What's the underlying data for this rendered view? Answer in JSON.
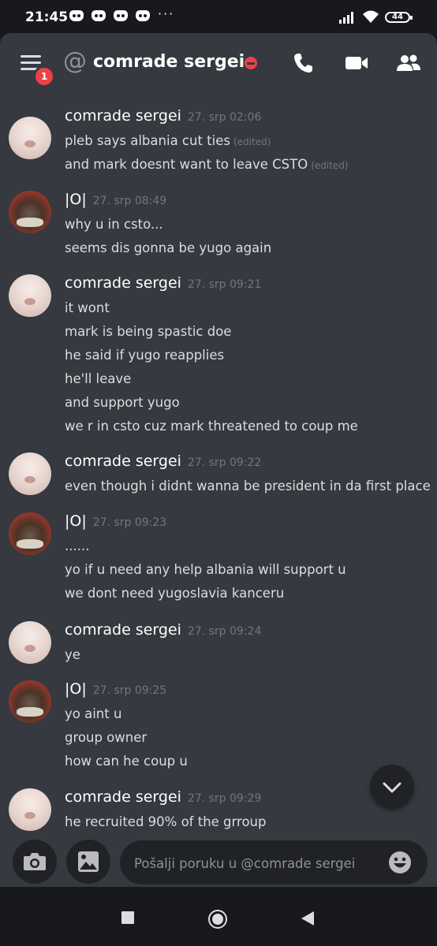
{
  "status_bar": {
    "time": "21:45",
    "overflow": "···",
    "battery": "44"
  },
  "header": {
    "menu_badge": "1",
    "at_symbol": "@",
    "channel_name": "comrade sergei"
  },
  "messages": [
    {
      "author": "comrade sergei",
      "avatar": "cat-avatar",
      "timestamp": "27. srp 02:06",
      "lines": [
        {
          "text": "pleb says albania cut ties",
          "edited": "(edited)"
        },
        {
          "text": "and mark doesnt want to leave CSTO",
          "edited": "(edited)"
        }
      ]
    },
    {
      "author": "|O|",
      "avatar": "dark-avatar",
      "timestamp": "27. srp 08:49",
      "lines": [
        {
          "text": "why u in csto..."
        },
        {
          "text": "seems dis gonna be yugo again"
        }
      ]
    },
    {
      "author": "comrade sergei",
      "avatar": "cat-avatar",
      "timestamp": "27. srp 09:21",
      "lines": [
        {
          "text": "it wont"
        },
        {
          "text": "mark is being spastic doe"
        },
        {
          "text": "he said if yugo reapplies"
        },
        {
          "text": "he'll leave"
        },
        {
          "text": "and support yugo"
        },
        {
          "text": "we r in csto cuz mark threatened to coup me"
        }
      ]
    },
    {
      "author": "comrade sergei",
      "avatar": "cat-avatar",
      "timestamp": "27. srp 09:22",
      "lines": [
        {
          "text": "even though i didnt wanna be president in da first place"
        }
      ]
    },
    {
      "author": "|O|",
      "avatar": "dark-avatar",
      "timestamp": "27. srp 09:23",
      "lines": [
        {
          "text": "......"
        },
        {
          "text": "yo if u need any help albania will support u"
        },
        {
          "text": "we dont need yugoslavia kanceru"
        }
      ]
    },
    {
      "author": "comrade sergei",
      "avatar": "cat-avatar",
      "timestamp": "27. srp 09:24",
      "lines": [
        {
          "text": "ye"
        }
      ]
    },
    {
      "author": "|O|",
      "avatar": "dark-avatar",
      "timestamp": "27. srp 09:25",
      "lines": [
        {
          "text": "yo aint u"
        },
        {
          "text": "group owner"
        },
        {
          "text": "how can he coup u"
        }
      ]
    },
    {
      "author": "comrade sergei",
      "avatar": "cat-avatar",
      "timestamp": "27. srp 09:29",
      "lines": [
        {
          "text": "he recruited 90% of the grroup"
        }
      ]
    }
  ],
  "composer": {
    "placeholder": "Pošalji poruku u @comrade sergei"
  },
  "colors": {
    "background": "#36393f",
    "dark": "#202225",
    "danger": "#ed4245",
    "muted": "#72767d"
  }
}
